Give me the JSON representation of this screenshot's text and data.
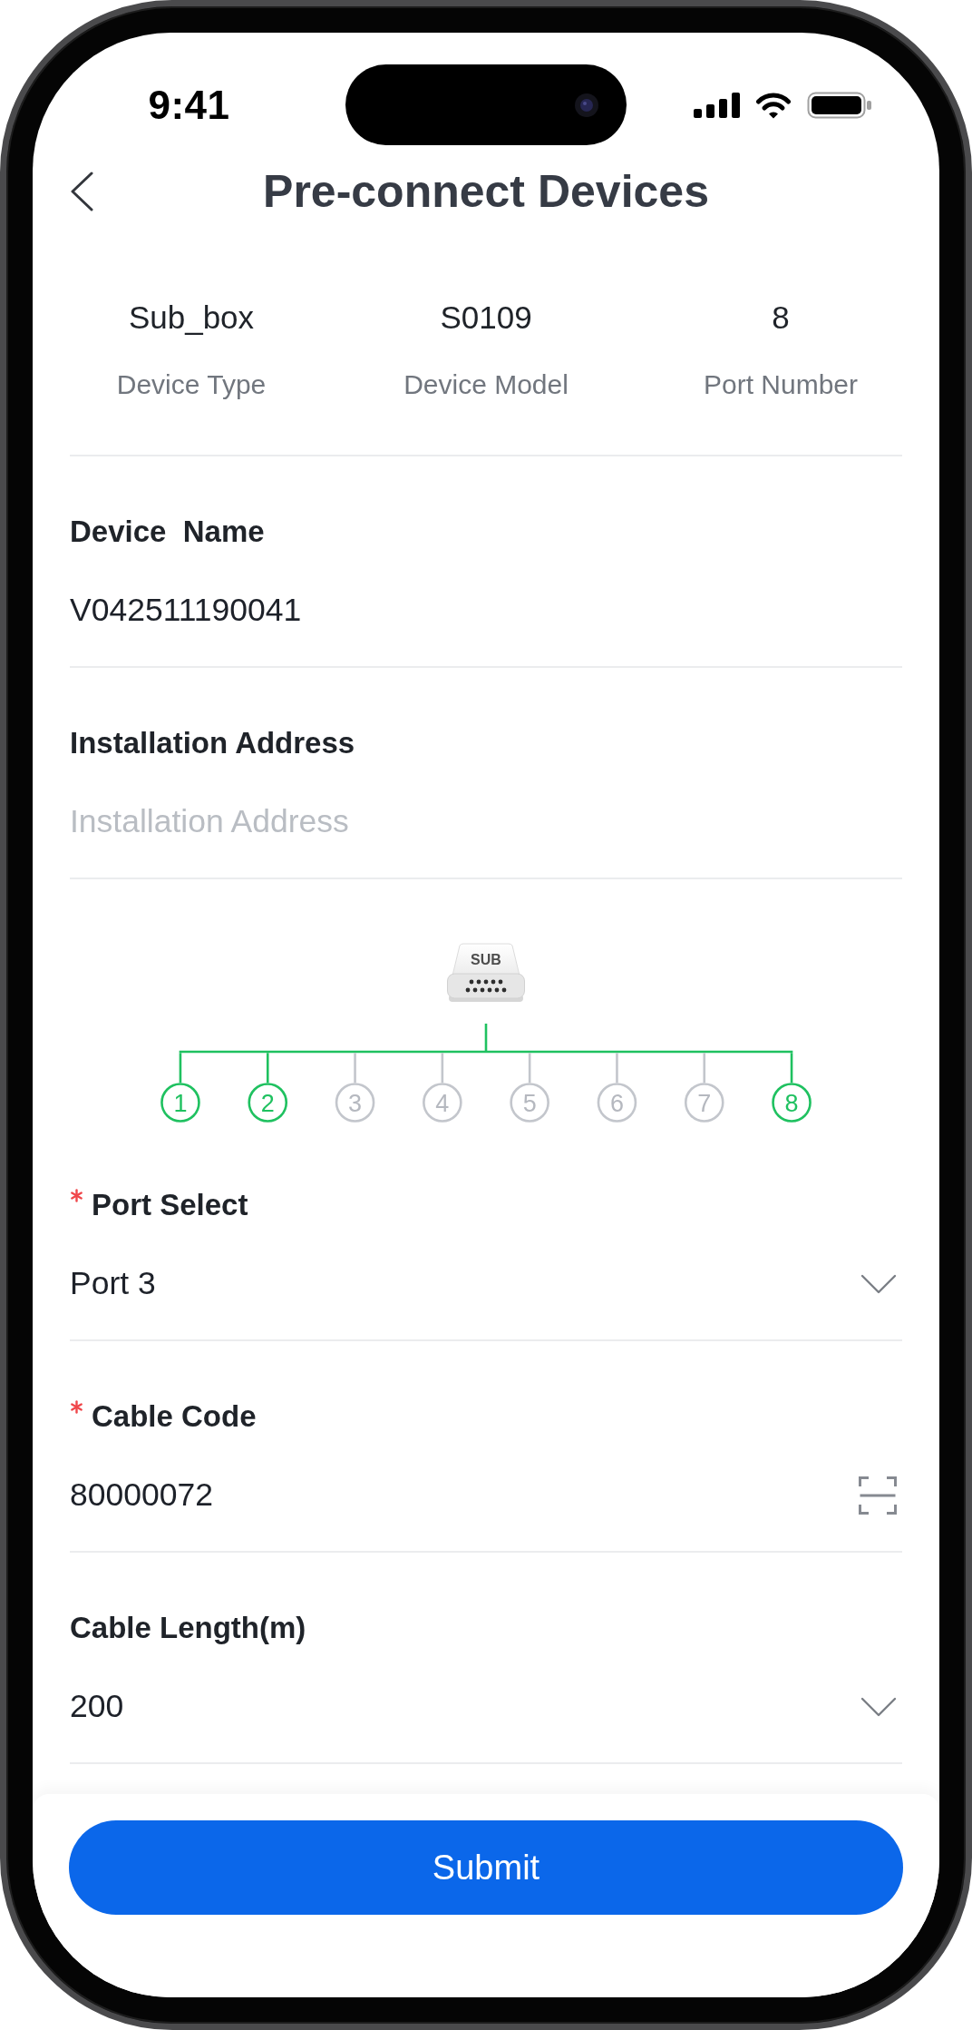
{
  "status_bar": {
    "time": "9:41"
  },
  "header": {
    "title": "Pre-connect Devices"
  },
  "device_info": [
    {
      "value": "Sub_box",
      "label": "Device Type"
    },
    {
      "value": "S0109",
      "label": "Device Model"
    },
    {
      "value": "8",
      "label": "Port Number"
    }
  ],
  "fields": [
    {
      "kind": "input",
      "label": "Device  Name",
      "required": false,
      "value": "V042511190041"
    },
    {
      "kind": "input",
      "label": "Installation Address",
      "required": false,
      "placeholder": "Installation Address"
    }
  ],
  "diagram": {
    "device_label": "SUB",
    "ports": [
      {
        "label": "1",
        "connected": true
      },
      {
        "label": "2",
        "connected": true
      },
      {
        "label": "3",
        "connected": false
      },
      {
        "label": "4",
        "connected": false
      },
      {
        "label": "5",
        "connected": false
      },
      {
        "label": "6",
        "connected": false
      },
      {
        "label": "7",
        "connected": false
      },
      {
        "label": "8",
        "connected": true
      }
    ]
  },
  "connection_fields": [
    {
      "kind": "select",
      "label": "Port Select",
      "required": true,
      "value": "Port 3"
    },
    {
      "kind": "scan",
      "label": "Cable Code",
      "required": true,
      "value": "80000072"
    },
    {
      "kind": "select",
      "label": "Cable Length(m)",
      "required": false,
      "value": "200"
    }
  ],
  "submit_button": {
    "label": "Submit"
  }
}
